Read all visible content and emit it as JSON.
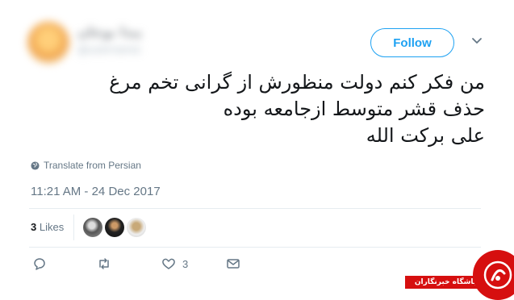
{
  "header": {
    "display_name": "پیدا بوجان",
    "handle": "@username",
    "follow_label": "Follow"
  },
  "tweet": {
    "lines": [
      "من فکر کنم دولت منظورش از گرانی تخم مرغ",
      "حذف قشر متوسط ازجامعه بوده",
      "علی برکت الله"
    ],
    "translate_label": "Translate from Persian",
    "timestamp": "11:21 AM - 24 Dec 2017"
  },
  "stats": {
    "likes_count": "3",
    "likes_label": "Likes"
  },
  "actions": {
    "like_count": "3"
  },
  "watermark": {
    "text": "باشگاه خبرنگاران"
  },
  "colors": {
    "accent": "#1da1f2",
    "muted": "#657786",
    "watermark_red": "#d60f0f"
  }
}
